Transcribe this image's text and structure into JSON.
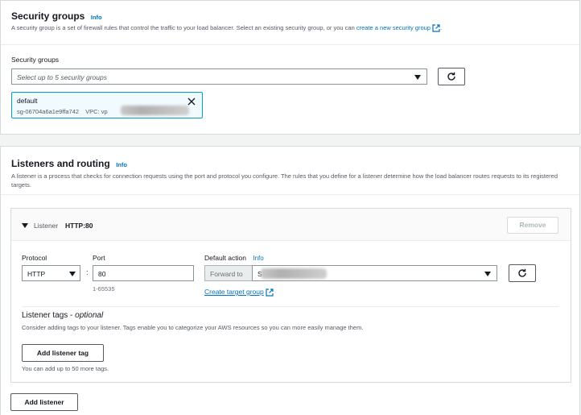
{
  "security_groups": {
    "title": "Security groups",
    "info": "Info",
    "description_prefix": "A security group is a set of firewall rules that control the traffic to your load balancer. Select an existing security group, or you can ",
    "description_link": "create a new security group",
    "description_suffix": ".",
    "field_label": "Security groups",
    "select_placeholder": "Select up to 5 security groups",
    "selected": {
      "name": "default",
      "id": "sg-06704a6a1e9ffa742",
      "vpc_label": "VPC: vp"
    }
  },
  "listeners": {
    "title": "Listeners and routing",
    "info": "Info",
    "description": "A listener is a process that checks for connection requests using the port and protocol you configure. The rules that you define for a listener determine how the load balancer routes requests to its registered targets.",
    "listener": {
      "label": "Listener",
      "name": "HTTP:80",
      "remove_label": "Remove",
      "protocol_label": "Protocol",
      "protocol_value": "HTTP",
      "port_label": "Port",
      "port_value": "80",
      "port_hint": "1-65535",
      "default_action_label": "Default action",
      "default_action_info": "Info",
      "forward_to": "Forward to",
      "forward_value_prefix": "S",
      "create_target_group": "Create target group",
      "tags_title": "Listener tags",
      "tags_optional": "optional",
      "tags_desc": "Consider adding tags to your listener. Tags enable you to categorize your AWS resources so you can more easily manage them.",
      "add_tag_label": "Add listener tag",
      "tags_hint": "You can add up to 50 more tags."
    },
    "add_listener_label": "Add listener"
  },
  "icons": {
    "refresh": "refresh-icon",
    "external": "external-link-icon",
    "close": "close-icon",
    "caret": "caret-down-icon",
    "collapse": "triangle-down-icon"
  },
  "colors": {
    "link": "#0073bb",
    "token_border": "#00a1c9",
    "token_bg": "#f1faff",
    "border": "#d5dbdb"
  }
}
